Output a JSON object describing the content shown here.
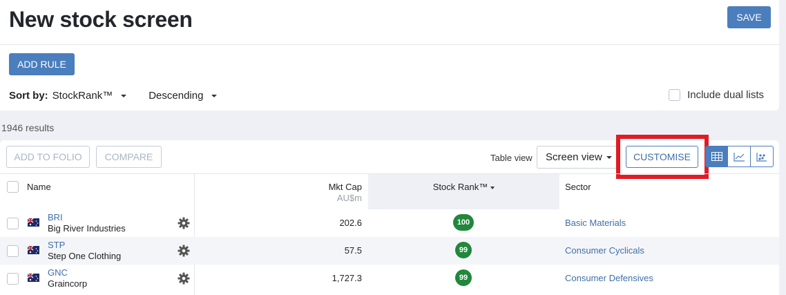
{
  "header": {
    "title": "New stock screen",
    "save_label": "SAVE",
    "add_rule_label": "ADD RULE",
    "sort_by_label": "Sort by:",
    "sort_by_value": "StockRank™",
    "sort_direction": "Descending",
    "include_dual_label": "Include dual lists"
  },
  "results": {
    "count_text": "1946 results"
  },
  "toolbar": {
    "add_to_folio_label": "ADD TO FOLIO",
    "compare_label": "COMPARE",
    "table_view_label": "Table view",
    "screen_view_value": "Screen view",
    "customise_label": "CUSTOMISE",
    "view_modes": [
      "table-icon",
      "line-chart-icon",
      "scatter-icon"
    ]
  },
  "table": {
    "columns": {
      "name": "Name",
      "mkt_cap": "Mkt Cap",
      "mkt_cap_unit": "AU$m",
      "stock_rank": "Stock Rank™",
      "sector": "Sector"
    },
    "rows": [
      {
        "ticker": "BRI",
        "company": "Big River Industries",
        "mkt_cap": "202.6",
        "rank": "100",
        "sector": "Basic Materials"
      },
      {
        "ticker": "STP",
        "company": "Step One Clothing",
        "mkt_cap": "57.5",
        "rank": "99",
        "sector": "Consumer Cyclicals"
      },
      {
        "ticker": "GNC",
        "company": "Graincorp",
        "mkt_cap": "1,727.3",
        "rank": "99",
        "sector": "Consumer Defensives"
      }
    ]
  },
  "colors": {
    "primary": "#4a7ebd",
    "rank_green": "#21873c",
    "highlight_red": "#e21a23",
    "link_blue": "#3f6fa8"
  }
}
